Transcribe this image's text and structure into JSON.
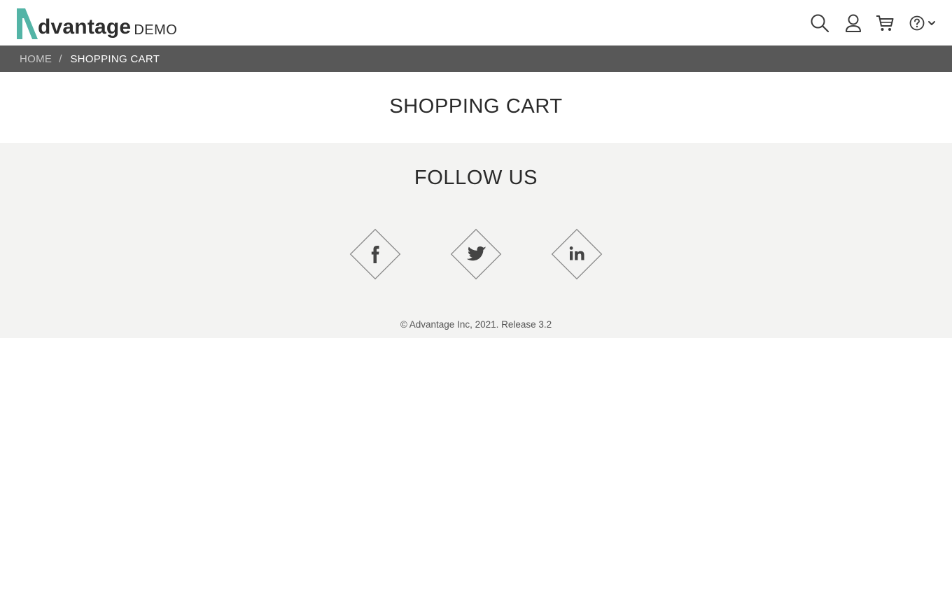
{
  "brand": {
    "name": "dvantage",
    "suffix": "DEMO",
    "accent_color": "#53b4a6"
  },
  "header": {
    "icons": [
      "search-icon",
      "user-icon",
      "cart-icon",
      "help-icon",
      "chevron-down-icon"
    ]
  },
  "breadcrumb": {
    "home": "HOME",
    "separator": "/",
    "current": "SHOPPING CART"
  },
  "main": {
    "title": "SHOPPING CART"
  },
  "footer": {
    "follow_title": "FOLLOW US",
    "social": [
      "facebook-icon",
      "twitter-icon",
      "linkedin-icon"
    ],
    "copyright": "© Advantage Inc, 2021. Release 3.2"
  },
  "colors": {
    "breadcrumb_bg": "#585858",
    "footer_bg": "#f3f3f2",
    "text": "#2a2a2a"
  }
}
